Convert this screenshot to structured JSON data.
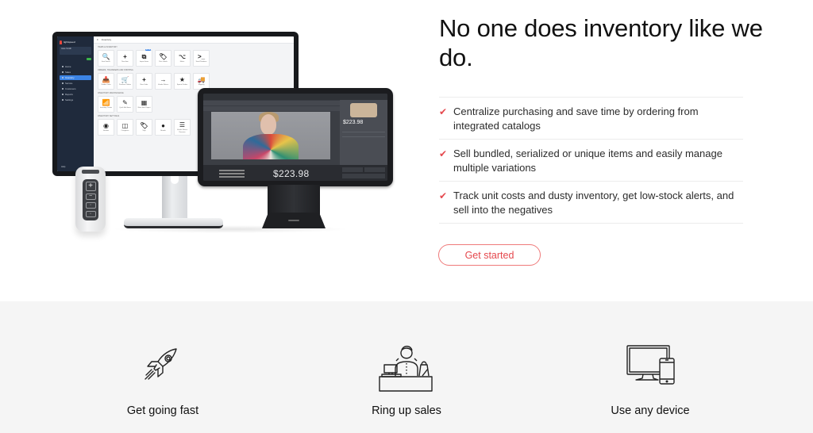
{
  "hero": {
    "headline": "No one does inventory like we do.",
    "features": [
      {
        "icon": "check-icon",
        "text": "Centralize purchasing and save time by ordering from integrated catalogs"
      },
      {
        "icon": "check-icon",
        "text": "Sell bundled, serialized or unique items and easily manage multiple variations"
      },
      {
        "icon": "check-icon",
        "text": "Track unit costs and dusty inventory, get low-stock alerts, and sell into the negatives"
      }
    ],
    "cta_label": "Get started",
    "accent_color": "#e5484d"
  },
  "illustration": {
    "monitor": {
      "brand": "lightspeed",
      "user_block": "Jane Smith",
      "topbar_title": "Inventory",
      "nav": [
        "Home",
        "Sales",
        "Inventory",
        "Service",
        "Customers",
        "Reports",
        "Settings"
      ],
      "active_nav": "Inventory",
      "help_label": "Help",
      "sections": [
        {
          "title": "Items & Inventory",
          "tiles": [
            {
              "glyph": "🔍",
              "label": "Item Search"
            },
            {
              "glyph": "+",
              "label": "New Item"
            },
            {
              "glyph": "⧉",
              "label": "Import Items",
              "badge": "BETA"
            },
            {
              "glyph": "🏷",
              "label": "Print Labels"
            },
            {
              "glyph": "⌥",
              "label": "Matrix"
            },
            {
              "glyph": ">_",
              "label": "Serial Numbers"
            }
          ]
        },
        {
          "title": "Orders, Transfers and Shipping",
          "tiles": [
            {
              "glyph": "📥",
              "label": "Vendor Order"
            },
            {
              "glyph": "🛒",
              "label": "Purchase Orders"
            },
            {
              "glyph": "+",
              "label": "New Order"
            },
            {
              "glyph": "→",
              "label": "Vendor Return"
            },
            {
              "glyph": "★",
              "label": "Special Orders"
            },
            {
              "glyph": "🚚",
              "label": "Shipping"
            }
          ]
        },
        {
          "title": "Inventory Maintenance",
          "tiles": [
            {
              "glyph": "📶",
              "label": "Inventory Counts"
            },
            {
              "glyph": "✎",
              "label": "Quick Edit Items"
            },
            {
              "glyph": "▦",
              "label": "Mass Item Report"
            }
          ]
        },
        {
          "title": "Inventory Settings",
          "tiles": [
            {
              "glyph": "◉",
              "label": "Vendors"
            },
            {
              "glyph": "◫",
              "label": "Categories"
            },
            {
              "glyph": "🏷",
              "label": "Tags"
            },
            {
              "glyph": "●",
              "label": "Brands"
            },
            {
              "glyph": "☰",
              "label": "Vendor Return Reasons"
            }
          ]
        }
      ]
    },
    "tablet": {
      "total": "$223.98",
      "item_price": "$223.98"
    }
  },
  "benefits": [
    {
      "icon": "rocket-icon",
      "label": "Get going fast"
    },
    {
      "icon": "cashier-icon",
      "label": "Ring up sales"
    },
    {
      "icon": "devices-icon",
      "label": "Use any device"
    }
  ],
  "colors": {
    "bottom_background": "#f5f5f5",
    "sidebar": "#1f2a3c",
    "active_nav": "#3c84e6"
  }
}
